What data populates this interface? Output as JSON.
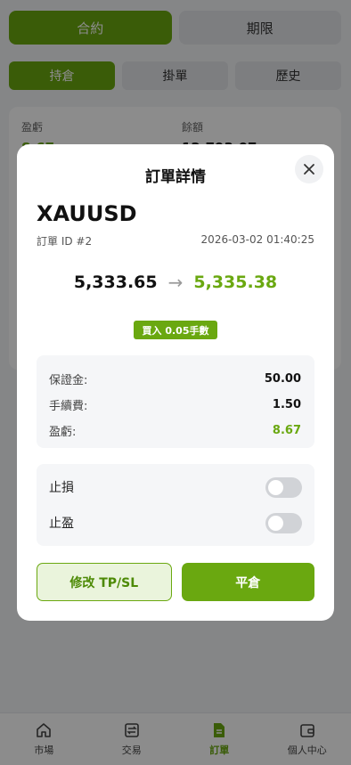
{
  "top_segment": {
    "contract": "合約",
    "futures": "期限"
  },
  "sub_tabs": {
    "positions": "持倉",
    "pending": "掛單",
    "history": "歷史"
  },
  "summary": {
    "pnl_label": "盈虧",
    "pnl_value": "8.67",
    "balance_label": "餘額",
    "balance_value": "12,793.07"
  },
  "modal": {
    "title": "訂單詳情",
    "symbol": "XAUUSD",
    "order_id": "訂單 ID #2",
    "timestamp": "2026-03-02 01:40:25",
    "open_price": "5,333.65",
    "arrow": "→",
    "current_price": "5,335.38",
    "side_badge": "買入 0.05手數",
    "details": [
      {
        "label": "保證金:",
        "value": "50.00"
      },
      {
        "label": "手續費:",
        "value": "1.50"
      },
      {
        "label": "盈虧:",
        "value": "8.67"
      }
    ],
    "toggles": [
      {
        "label": "止損",
        "on": false
      },
      {
        "label": "止盈",
        "on": false
      }
    ],
    "modify_button": "修改 TP/SL",
    "close_position_button": "平倉"
  },
  "bottom_nav": [
    {
      "label": "市場",
      "icon": "home-icon",
      "active": false
    },
    {
      "label": "交易",
      "icon": "trade-icon",
      "active": false
    },
    {
      "label": "訂單",
      "icon": "order-icon",
      "active": true
    },
    {
      "label": "個人中心",
      "icon": "wallet-icon",
      "active": false
    }
  ],
  "colors": {
    "accent": "#6aa810",
    "overlay": "rgba(0,0,0,0.45)"
  }
}
